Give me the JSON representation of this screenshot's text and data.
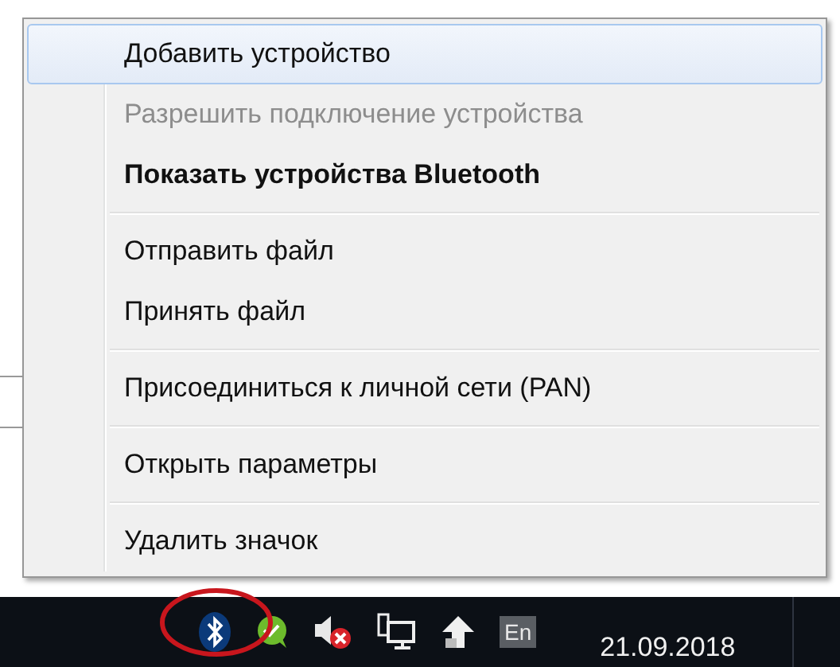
{
  "menu": {
    "groups": [
      {
        "items": [
          {
            "label": "Добавить устройство",
            "highlighted": true,
            "disabled": false,
            "bold": false
          },
          {
            "label": "Разрешить подключение устройства",
            "highlighted": false,
            "disabled": true,
            "bold": false
          },
          {
            "label": "Показать устройства Bluetooth",
            "highlighted": false,
            "disabled": false,
            "bold": true
          }
        ]
      },
      {
        "items": [
          {
            "label": "Отправить файл",
            "highlighted": false,
            "disabled": false,
            "bold": false
          },
          {
            "label": "Принять файл",
            "highlighted": false,
            "disabled": false,
            "bold": false
          }
        ]
      },
      {
        "items": [
          {
            "label": "Присоединиться к личной сети (PAN)",
            "highlighted": false,
            "disabled": false,
            "bold": false
          }
        ]
      },
      {
        "items": [
          {
            "label": "Открыть параметры",
            "highlighted": false,
            "disabled": false,
            "bold": false
          }
        ]
      },
      {
        "items": [
          {
            "label": "Удалить значок",
            "highlighted": false,
            "disabled": false,
            "bold": false
          }
        ]
      }
    ]
  },
  "taskbar": {
    "language": "En",
    "date": "21.09.2018"
  }
}
